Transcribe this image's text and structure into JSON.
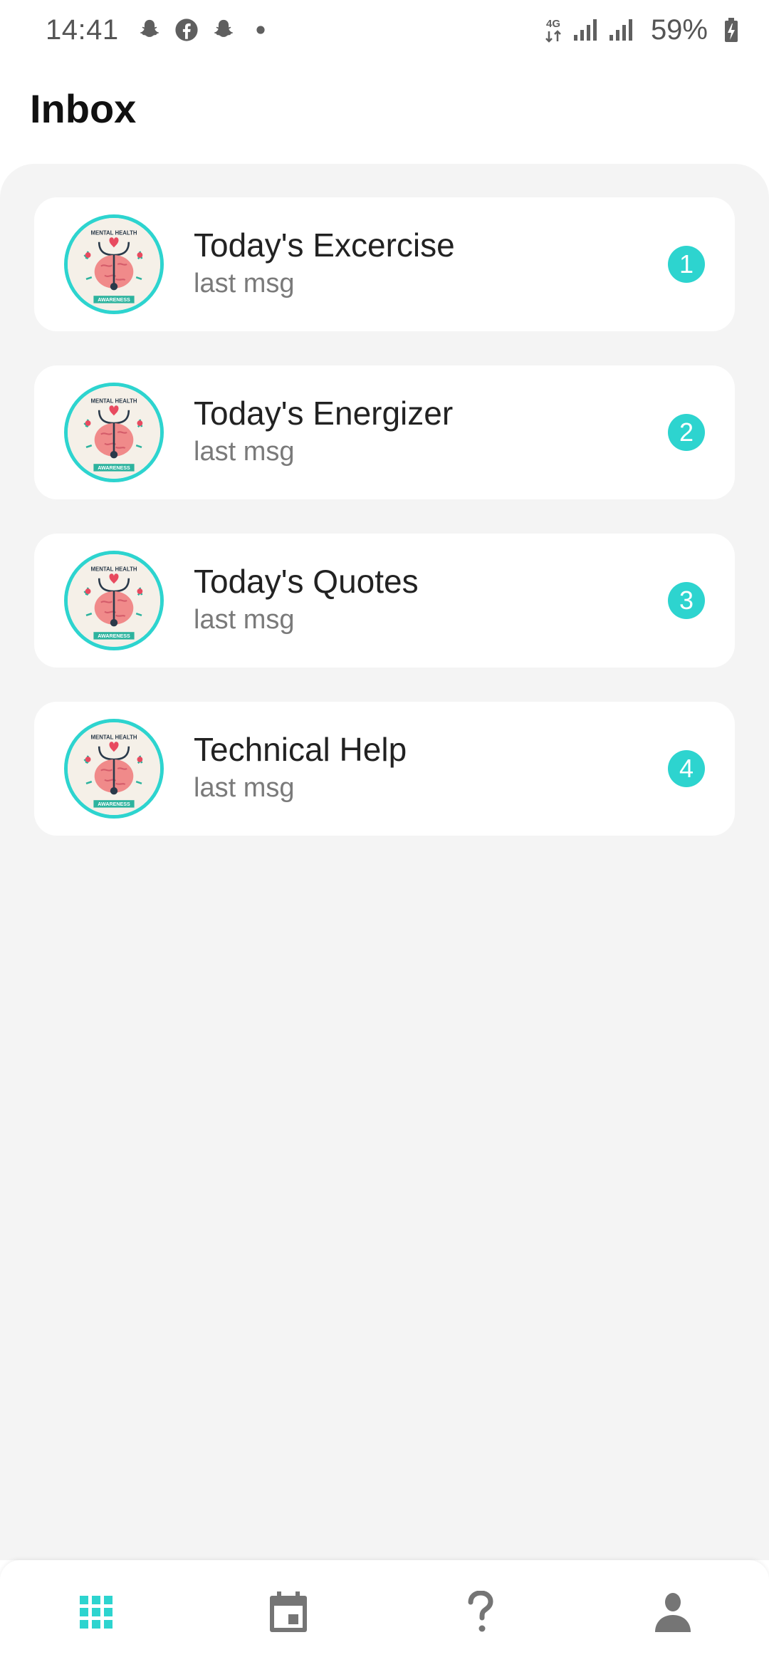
{
  "status_bar": {
    "time": "14:41",
    "notification_icons": [
      "snapchat-icon",
      "facebook-icon",
      "snapchat-icon",
      "dot-icon"
    ],
    "network": "4G",
    "battery": "59%"
  },
  "header": {
    "title": "Inbox"
  },
  "chats": [
    {
      "name": "Today's Excercise",
      "last_message": "last msg",
      "badge": "1",
      "avatar": "mental-health-awareness-icon"
    },
    {
      "name": "Today's Energizer",
      "last_message": "last msg",
      "badge": "2",
      "avatar": "mental-health-awareness-icon"
    },
    {
      "name": "Today's Quotes",
      "last_message": "last msg",
      "badge": "3",
      "avatar": "mental-health-awareness-icon"
    },
    {
      "name": "Technical Help",
      "last_message": "last msg",
      "badge": "4",
      "avatar": "mental-health-awareness-icon"
    }
  ],
  "bottom_nav": [
    {
      "icon": "grid-icon",
      "active": true
    },
    {
      "icon": "calendar-icon",
      "active": false
    },
    {
      "icon": "help-icon",
      "active": false
    },
    {
      "icon": "profile-icon",
      "active": false
    }
  ],
  "colors": {
    "accent": "#2dd4cf",
    "background": "#f4f4f4",
    "card": "#ffffff",
    "inactive_icon": "#757575"
  }
}
